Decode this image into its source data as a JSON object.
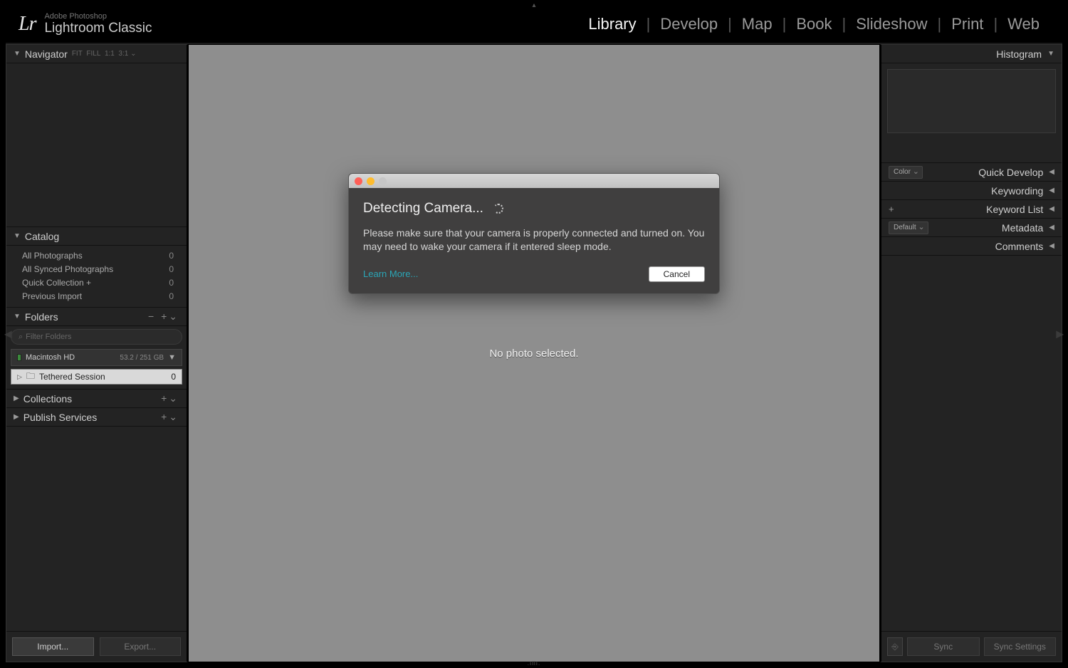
{
  "brand": {
    "sub": "Adobe Photoshop",
    "main": "Lightroom Classic",
    "logo": "Lr"
  },
  "modules": {
    "library": "Library",
    "develop": "Develop",
    "map": "Map",
    "book": "Book",
    "slideshow": "Slideshow",
    "print": "Print",
    "web": "Web"
  },
  "leftPanels": {
    "navigator": "Navigator",
    "catalog": {
      "title": "Catalog",
      "rows": [
        {
          "label": "All Photographs",
          "count": "0"
        },
        {
          "label": "All Synced Photographs",
          "count": "0"
        },
        {
          "label": "Quick Collection  +",
          "count": "0"
        },
        {
          "label": "Previous Import",
          "count": "0"
        }
      ]
    },
    "folders": {
      "title": "Folders",
      "filterPlaceholder": "Filter Folders",
      "volume": {
        "name": "Macintosh HD",
        "usage": "53.2 / 251 GB"
      },
      "folder": {
        "name": "Tethered Session",
        "count": "0"
      }
    },
    "collections": "Collections",
    "publish": "Publish Services",
    "importBtn": "Import...",
    "exportBtn": "Export..."
  },
  "center": {
    "placeholder": "No photo selected."
  },
  "rightPanels": {
    "histogram": "Histogram",
    "quickDevelopColor": "Color",
    "quickDevelop": "Quick Develop",
    "keywording": "Keywording",
    "keywordList": "Keyword List",
    "metadataPreset": "Default",
    "metadata": "Metadata",
    "comments": "Comments",
    "sync": "Sync",
    "syncSettings": "Sync Settings"
  },
  "modal": {
    "title": "Detecting Camera...",
    "text": "Please make sure that your camera is properly connected and turned on. You may need to wake your camera if it entered sleep mode.",
    "learnMore": "Learn More...",
    "cancel": "Cancel"
  }
}
